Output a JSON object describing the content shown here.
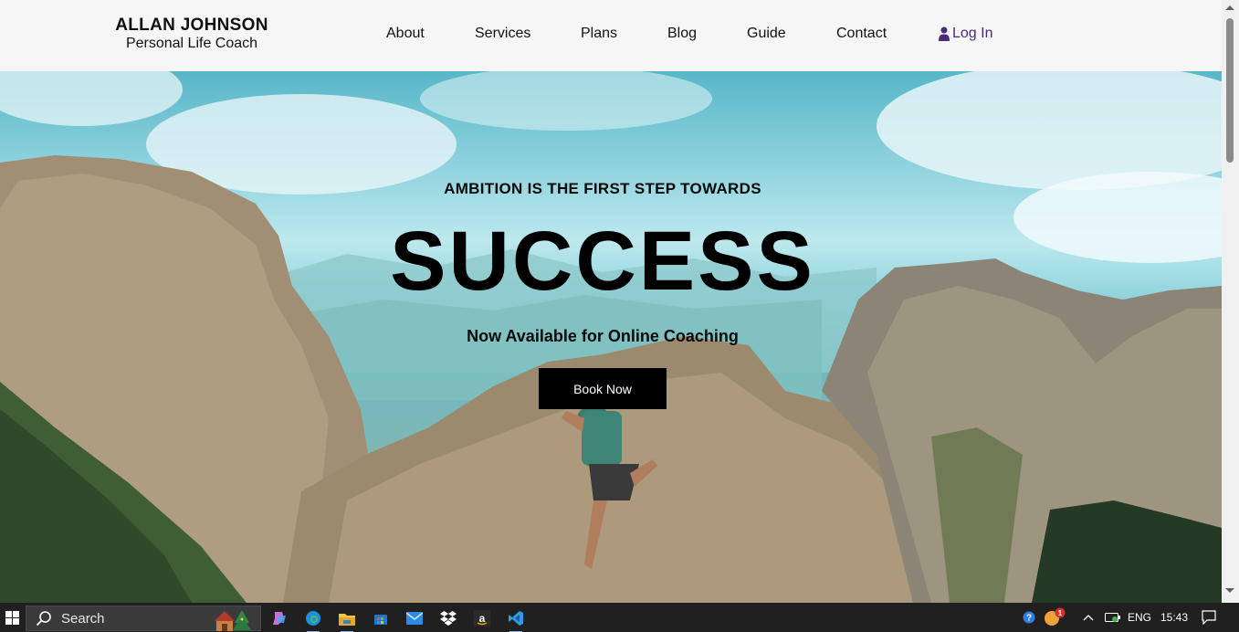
{
  "header": {
    "brand_name": "ALLAN JOHNSON",
    "brand_tagline": "Personal Life Coach",
    "nav": [
      {
        "label": "About"
      },
      {
        "label": "Services"
      },
      {
        "label": "Plans"
      },
      {
        "label": "Blog"
      },
      {
        "label": "Guide"
      },
      {
        "label": "Contact"
      }
    ],
    "login_label": "Log In",
    "login_icon": "user-icon",
    "login_color": "#4b2a7a"
  },
  "hero": {
    "kicker": "AMBITION IS THE FIRST STEP TOWARDS",
    "headline": "SUCCESS",
    "subline": "Now Available for Online Coaching",
    "cta_label": "Book Now",
    "cta_color": "#000000"
  },
  "taskbar": {
    "search_placeholder": "Search",
    "apps": [
      "copilot-icon",
      "edge-icon",
      "file-explorer-icon",
      "store-icon",
      "mail-icon",
      "dropbox-icon",
      "amazon-icon",
      "vscode-icon"
    ],
    "language": "ENG",
    "time": "15:43",
    "notification_count": "1"
  }
}
